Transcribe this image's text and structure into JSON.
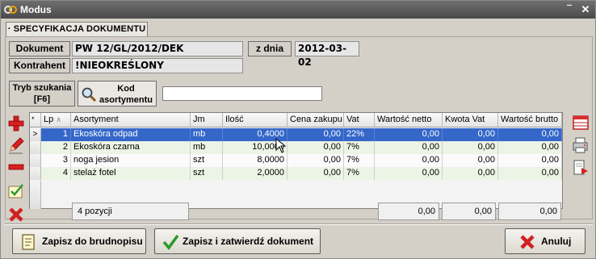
{
  "window": {
    "title": "Modus"
  },
  "tab": {
    "label": "· SPECYFIKACJA DOKUMENTU ·"
  },
  "header": {
    "dokument_label": "Dokument",
    "dokument_value": "PW 12/GL/2012/DEK",
    "zdnia_label": "z dnia",
    "zdnia_value": "2012-03-02",
    "kontrahent_label": "Kontrahent",
    "kontrahent_value": "!NIEOKREŚLONY"
  },
  "search": {
    "tryb_line1": "Tryb szukania",
    "tryb_line2": "[F6]",
    "kod_line1": "Kod",
    "kod_line2": "asortymentu",
    "value": ""
  },
  "grid": {
    "columns": [
      "Lp",
      "Asortyment",
      "Jm",
      "Ilość",
      "Cena zakupu",
      "Vat",
      "Wartość netto",
      "Kwota Vat",
      "Wartość brutto"
    ],
    "rows": [
      {
        "lp": "1",
        "asortyment": "Ekoskóra odpad",
        "jm": "mb",
        "ilosc": "0,4000",
        "cena": "0,00",
        "vat": "22%",
        "netto": "0,00",
        "kwota_vat": "0,00",
        "brutto": "0,00"
      },
      {
        "lp": "2",
        "asortyment": "Ekoskóra czarna",
        "jm": "mb",
        "ilosc": "10,0000",
        "cena": "0,00",
        "vat": "7%",
        "netto": "0,00",
        "kwota_vat": "0,00",
        "brutto": "0,00"
      },
      {
        "lp": "3",
        "asortyment": "noga jesion",
        "jm": "szt",
        "ilosc": "8,0000",
        "cena": "0,00",
        "vat": "7%",
        "netto": "0,00",
        "kwota_vat": "0,00",
        "brutto": "0,00"
      },
      {
        "lp": "4",
        "asortyment": "stelaż fotel",
        "jm": "szt",
        "ilosc": "2,0000",
        "cena": "0,00",
        "vat": "7%",
        "netto": "0,00",
        "kwota_vat": "0,00",
        "brutto": "0,00"
      }
    ],
    "selected_row_marker": ">",
    "footer": {
      "count": "4 pozycji",
      "netto": "0,00",
      "kwota_vat": "0,00",
      "brutto": "0,00"
    }
  },
  "buttons": {
    "draft": "Zapisz do brudnopisu",
    "save_confirm": "Zapisz i zatwierdź dokument",
    "cancel": "Anuluj"
  },
  "icons": {
    "left": [
      "add-icon",
      "edit-icon",
      "remove-icon",
      "notes-icon",
      "delete-icon"
    ],
    "right": [
      "table-icon",
      "print-icon",
      "export-icon"
    ]
  }
}
